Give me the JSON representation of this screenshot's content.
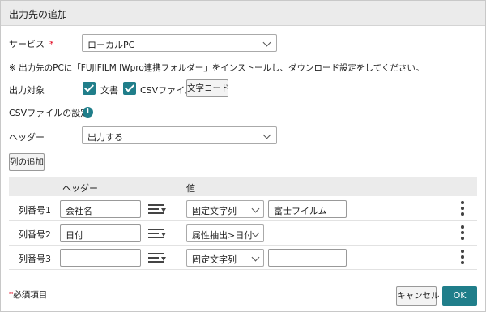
{
  "dialog": {
    "title": "出力先の追加"
  },
  "service": {
    "label": "サービス",
    "required_mark": "*",
    "value": "ローカルPC"
  },
  "note": "※ 出力先のPCに「FUJIFILM IWpro連携フォルダー」をインストールし、ダウンロード設定をしてください。",
  "output_target": {
    "label": "出力対象",
    "options": [
      {
        "label": "文書",
        "checked": true
      },
      {
        "label": "CSVファイル",
        "checked": true
      }
    ],
    "charset_button": "文字コード"
  },
  "csv_settings": {
    "label": "CSVファイルの設定",
    "info_glyph": "i",
    "header_label": "ヘッダー",
    "header_value": "出力する"
  },
  "add_column_button": "列の追加",
  "table": {
    "columns": [
      "ヘッダー",
      "値"
    ],
    "rows": [
      {
        "label": "列番号1",
        "header": "会社名",
        "type": "固定文字列",
        "value": "富士フイルム"
      },
      {
        "label": "列番号2",
        "header": "日付",
        "type": "属性抽出>日付",
        "value": ""
      },
      {
        "label": "列番号3",
        "header": "",
        "type": "固定文字列",
        "value": ""
      }
    ]
  },
  "footer": {
    "required_mark": "*",
    "required_note": "必須項目",
    "cancel": "キャンセル",
    "ok": "OK"
  },
  "colors": {
    "accent": "#207e8a",
    "required": "#e0001a",
    "titlebar": "#ebebeb"
  },
  "icons": [
    "chevron-down-icon",
    "checkbox-checked-icon",
    "info-icon",
    "list-sort-icon",
    "kebab-menu-icon"
  ]
}
